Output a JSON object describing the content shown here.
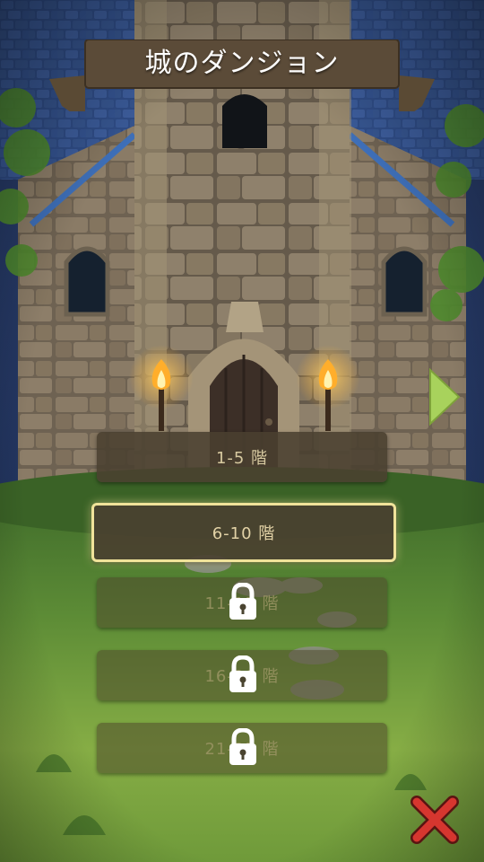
{
  "title": "城のダンジョン",
  "floors": [
    {
      "label": "1-5 階",
      "locked": false,
      "selected": false
    },
    {
      "label": "6-10 階",
      "locked": false,
      "selected": true
    },
    {
      "label": "11-15 階",
      "locked": true,
      "selected": false
    },
    {
      "label": "16-20 階",
      "locked": true,
      "selected": false
    },
    {
      "label": "21-25 階",
      "locked": true,
      "selected": false
    }
  ],
  "icons": {
    "next": "triangle-right-icon",
    "close": "close-x-icon",
    "lock": "padlock-icon",
    "torch": "torch-icon"
  },
  "colors": {
    "roof": "#2e4c86",
    "stone": "#8c7a64",
    "grass": "#6a9a38",
    "close": "#c8302c",
    "selected_border": "#f0e39a"
  }
}
